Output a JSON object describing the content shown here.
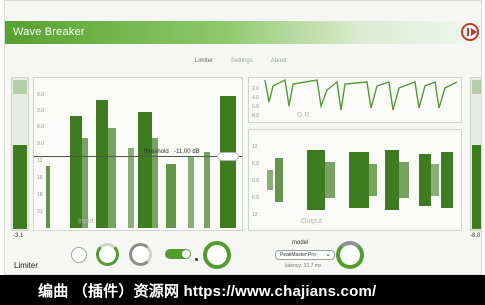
{
  "window": {
    "title": "Wave Breaker"
  },
  "tabs": [
    {
      "label": "Limiter",
      "active": true
    },
    {
      "label": "Settings",
      "active": false
    },
    {
      "label": "About",
      "active": false
    }
  ],
  "input_meter": {
    "value": "-3.1",
    "level": 0.55
  },
  "output_meter": {
    "value": "-8.0",
    "level": 0.55
  },
  "input_panel": {
    "axis": [
      "0.0",
      "3.0",
      "6.0",
      "9.0",
      "12",
      "15",
      "18",
      "21"
    ],
    "threshold_label": "threshold",
    "threshold_value": "-11.00 dB",
    "label": "Input"
  },
  "gr_panel": {
    "axis": [
      "2.0",
      "4.0",
      "6.0",
      "8.0"
    ],
    "label": "G.R."
  },
  "output_panel": {
    "axis": [
      "12",
      "6.0",
      "0.0",
      "6.0",
      "12"
    ],
    "label": "Output"
  },
  "bottom": {
    "section_label": "Limiter",
    "model_label": "model",
    "model_value": "PeakMaster Pro",
    "latency": "latency: 32.7 ms"
  },
  "footer": {
    "text": "编曲 （插件）资源网   https://www.chajians.com/"
  },
  "colors": {
    "accent": "#3d7d1f",
    "accent_light": "#8bc869",
    "logo_red": "#c0392b"
  }
}
